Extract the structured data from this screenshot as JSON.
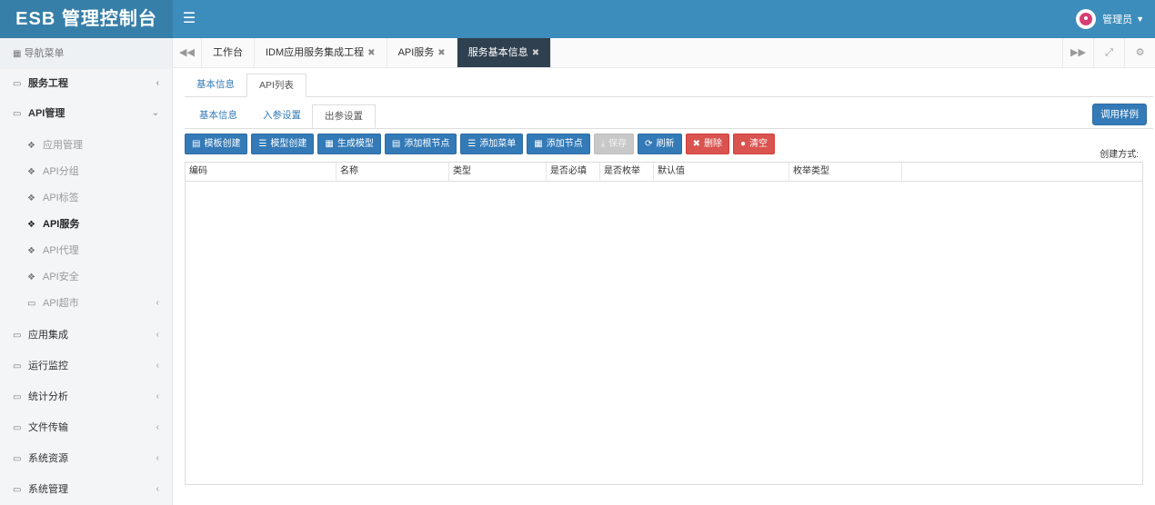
{
  "header": {
    "app_title": "ESB 管理控制台",
    "menu_toggle_icon": "hamburger-icon",
    "user_name": "管理员"
  },
  "sidebar": {
    "nav_title": "导航菜单",
    "items": [
      {
        "label": "服务工程",
        "icon": "folder-icon",
        "expanded": false
      },
      {
        "label": "API管理",
        "icon": "folder-icon",
        "expanded": true
      },
      {
        "label": "应用管理",
        "icon": "leaf-icon"
      },
      {
        "label": "API分组",
        "icon": "leaf-icon"
      },
      {
        "label": "API标签",
        "icon": "leaf-icon"
      },
      {
        "label": "API服务",
        "icon": "leaf-icon",
        "active": true
      },
      {
        "label": "API代理",
        "icon": "leaf-icon"
      },
      {
        "label": "API安全",
        "icon": "leaf-icon"
      },
      {
        "label": "API超市",
        "icon": "folder-icon"
      },
      {
        "label": "应用集成",
        "icon": "folder-icon"
      },
      {
        "label": "运行监控",
        "icon": "folder-icon"
      },
      {
        "label": "统计分析",
        "icon": "folder-icon"
      },
      {
        "label": "文件传输",
        "icon": "folder-icon"
      },
      {
        "label": "系统资源",
        "icon": "folder-icon"
      },
      {
        "label": "系统管理",
        "icon": "folder-icon"
      }
    ]
  },
  "tabs": [
    {
      "label": "工作台",
      "closable": false
    },
    {
      "label": "IDM应用服务集成工程",
      "closable": true
    },
    {
      "label": "API服务",
      "closable": true
    },
    {
      "label": "服务基本信息",
      "closable": true,
      "active": true
    }
  ],
  "tab_close_glyph": "✖",
  "outer_tabs": [
    {
      "label": "基本信息"
    },
    {
      "label": "API列表",
      "active": true
    }
  ],
  "inner_tabs": [
    {
      "label": "基本信息"
    },
    {
      "label": "入参设置"
    },
    {
      "label": "出参设置",
      "active": true
    }
  ],
  "call_example_label": "调用样例",
  "toolbar": [
    {
      "label": "模板创建",
      "icon": "list-icon",
      "state": "primary"
    },
    {
      "label": "模型创建",
      "icon": "stack-icon",
      "state": "primary"
    },
    {
      "label": "生成模型",
      "icon": "model-icon",
      "state": "primary"
    },
    {
      "label": "添加根节点",
      "icon": "list-icon",
      "state": "primary"
    },
    {
      "label": "添加菜单",
      "icon": "stack-icon",
      "state": "primary"
    },
    {
      "label": "添加节点",
      "icon": "model-icon",
      "state": "primary"
    },
    {
      "label": "保存",
      "icon": "save-icon",
      "state": "disabled"
    },
    {
      "label": "刷新",
      "icon": "refresh-icon",
      "state": "primary"
    },
    {
      "label": "删除",
      "icon": "delete-icon",
      "state": "danger"
    },
    {
      "label": "清空",
      "icon": "clear-icon",
      "state": "danger"
    }
  ],
  "create_method_label": "创建方式:",
  "table": {
    "columns": [
      "编码",
      "名称",
      "类型",
      "是否必填",
      "是否枚举",
      "默认值",
      "枚举类型",
      ""
    ],
    "rows": []
  },
  "colors": {
    "header_bg": "#3c8dbc",
    "logo_bg": "#367fa9",
    "primary": "#337ab7",
    "danger": "#d9534f",
    "active_tab": "#2f4050"
  }
}
